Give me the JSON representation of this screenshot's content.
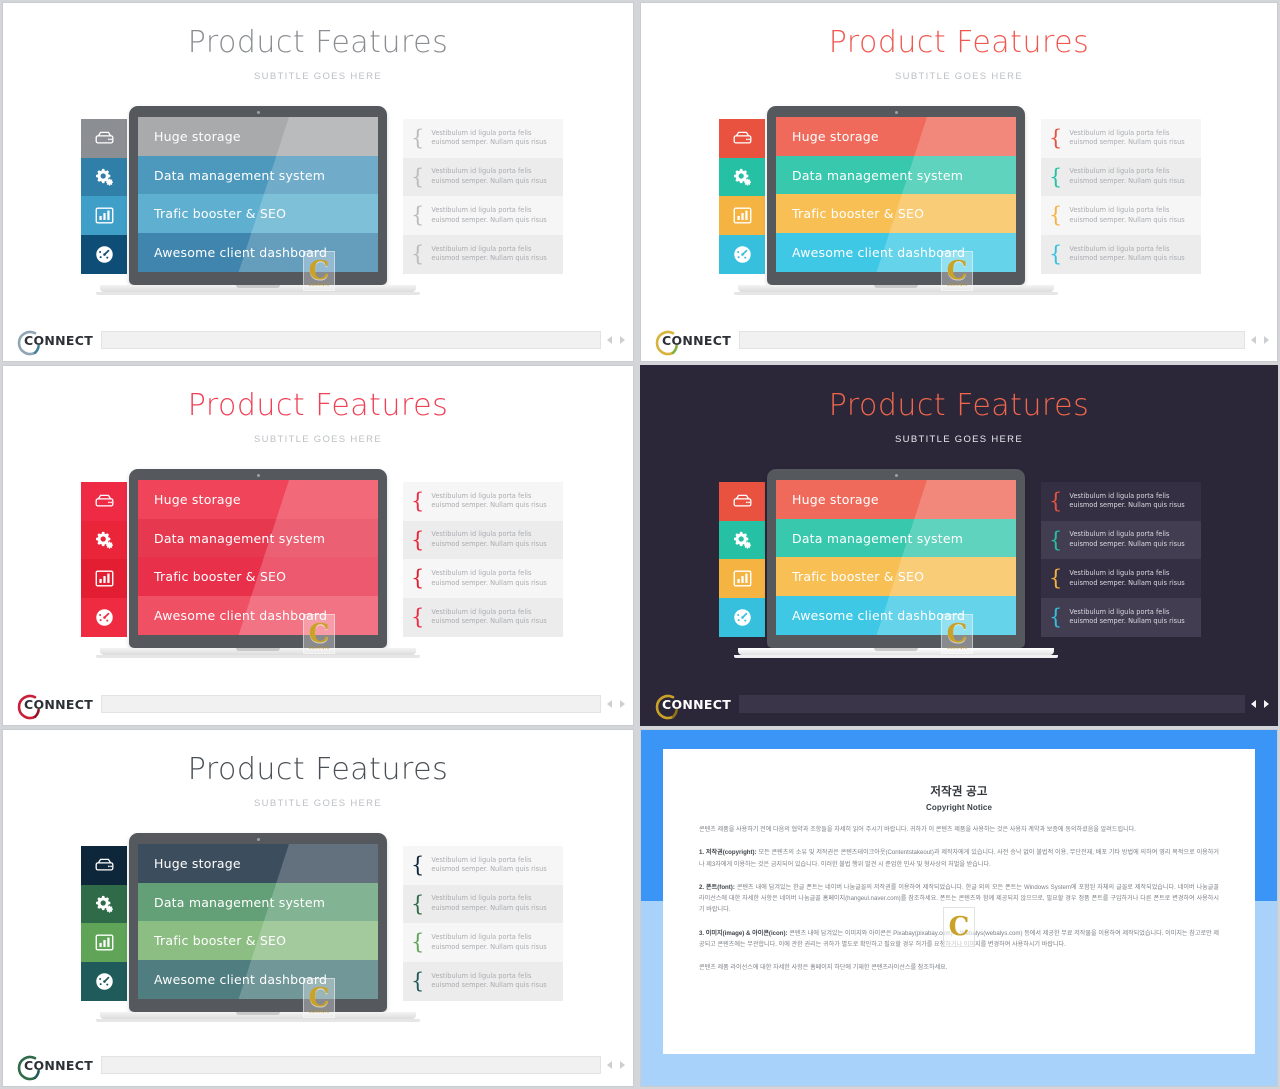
{
  "slide": {
    "title": "Product Features",
    "subtitle": "SUBTITLE GOES HERE",
    "rows": [
      {
        "label": "Huge storage",
        "icon": "hard-drive-icon"
      },
      {
        "label": "Data management system",
        "icon": "gears-icon"
      },
      {
        "label": "Trafic booster & SEO",
        "icon": "bar-chart-icon"
      },
      {
        "label": "Awesome client dashboard",
        "icon": "gauge-icon"
      }
    ],
    "quote_text": "Vestibulum id ligula porta felis euismod semper. Nullam quis risus",
    "brace": "{",
    "watermark": {
      "letter": "C",
      "caption": "CONTENTS"
    }
  },
  "footer": {
    "logo_text": "CONNECT",
    "prev_label": "◂",
    "next_label": "▸"
  },
  "themes": [
    {
      "name": "blue-grey",
      "title_color": "#8a8d91",
      "icon_colors": [
        "#8b8e92",
        "#2f7fa8",
        "#3f9fc9",
        "#0e4d75"
      ],
      "row_colors": [
        "#a9aaac",
        "#4d98bd",
        "#5fb0d0",
        "#3f85ad"
      ]
    },
    {
      "name": "multicolor",
      "title_color": "#f0574f",
      "icon_colors": [
        "#e8523f",
        "#26c0a5",
        "#f5b342",
        "#36c0dd"
      ],
      "row_colors": [
        "#ef6a5a",
        "#37c8ad",
        "#f8bf55",
        "#3fc8e5"
      ]
    },
    {
      "name": "crimson",
      "title_color": "#ef4056",
      "icon_colors": [
        "#ee2a45",
        "#ea2439",
        "#e31e33",
        "#ef2b42"
      ],
      "row_colors": [
        "#ef4459",
        "#e63950",
        "#e8304a",
        "#ef5064"
      ]
    },
    {
      "name": "dark",
      "title_color": "#f2674c",
      "icon_colors": [
        "#e8523f",
        "#26c0a5",
        "#f5b342",
        "#36c0dd"
      ],
      "row_colors": [
        "#ef6a5a",
        "#37c8ad",
        "#f8bf55",
        "#3fc8e5"
      ]
    },
    {
      "name": "forest",
      "title_color": "#4a4f55",
      "icon_colors": [
        "#0e2639",
        "#2f6b48",
        "#5fa457",
        "#1f5b5a"
      ],
      "row_colors": [
        "#3c4d5e",
        "#63a078",
        "#8cbd83",
        "#4f7d80"
      ]
    }
  ],
  "copyright": {
    "heading_ko": "저작권 공고",
    "heading_en": "Copyright Notice",
    "paragraphs": [
      "콘텐츠 제품을 사용하기 전에 다음의 협약과 조항들을 자세히 읽어 주시기 바랍니다. 귀하가 이 콘텐츠 제품을 사용하는 것은 사용자 계약과 보증에 동의하셨음을 알려드립니다.",
      "1. 저작권(copyright): 모든 콘텐츠의 소유 및 저작권은 콘텐츠테이크아웃(Contentstakeout)과 제작자에게 있습니다. 사전 승낙 없이 불법적 이용, 무단전재, 배포 기타 방법에 의하여 영리 목적으로 이용하거나 제3자에게 이용하는 것은 금지되어 있습니다. 이러한 불법 행위 발견 시 준엄한 민사 및 형사상의 처벌을 받습니다.",
      "2. 폰트(font): 콘텐츠 내에 담겨있는 한글 폰트는 네이버 나눔글꼴의 저작권를 이용하여 제작되었습니다. 한글 외의 모든 폰트는 Windows System에 포함된 자체의 글꼴로 제작되었습니다. 네이버 나눔글꼴 라이선스에 대한 자세한 사항은 네이버 나눔글꼴 홈페이지(hangeul.naver.com)를 참조하세요. 폰트는 콘텐츠와 함께 제공되지 않으므로, 필요할 경우 정품 폰트를 구입하거나 다른 폰트로 변경하여 사용하시기 바랍니다.",
      "3. 이미지(image) & 아이콘(icon): 콘텐츠 내에 담겨있는 이미지와 아이콘은 Pixabay(pixabay.com)와 Webalys(webalys.com) 등에서 제공한 무료 저작물을 이용하여 제작되었습니다. 이미지는 참고로만 제공되고 콘텐츠에는 무관합니다. 이에 관한 권리는 귀하가 별도로 확인하고 필요할 경우 허가를 요청하거나 이미지를 변경하여 사용하시기 바랍니다.",
      "콘텐츠 제품 라이선스에 대한 자세한 사항은 홈페이지 하단에 기재한 콘텐츠라이선스를 참조하세요."
    ],
    "watermark_letter": "C"
  }
}
